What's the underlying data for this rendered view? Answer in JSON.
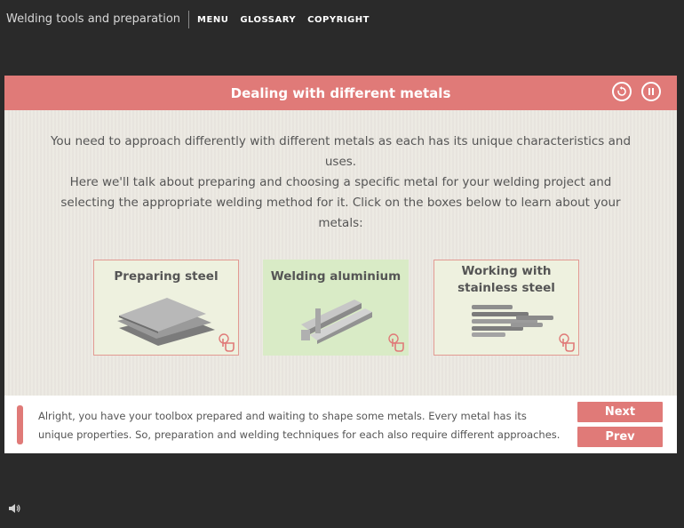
{
  "course": {
    "title": "Welding tools and preparation"
  },
  "nav": {
    "items": [
      "MENU",
      "GLOSSARY",
      "COPYRIGHT"
    ]
  },
  "panel": {
    "title": "Dealing with different metals",
    "intro": [
      "You need to approach differently with different metals as each has its unique characteristics and uses.",
      "Here we'll talk about preparing and choosing a specific metal for your welding project and selecting the appropriate welding method for it. Click on the boxes below to learn about your metals:"
    ],
    "cards": [
      {
        "label": "Preparing steel",
        "icon": "steel-sheets-image",
        "selected": false
      },
      {
        "label": "Welding aluminium",
        "icon": "aluminium-profiles-image",
        "selected": true
      },
      {
        "label": "Working with stainless steel",
        "icon": "stainless-steel-pipes-image",
        "selected": false
      }
    ]
  },
  "footer": {
    "text": "Alright, you have your toolbox prepared and waiting to shape some metals. Every metal has its unique properties. So, preparation and welding techniques for each also require different approaches.",
    "next_label": "Next",
    "prev_label": "Prev"
  },
  "colors": {
    "accent": "#e07a78",
    "card_bg": "#eef1df",
    "card_selected_bg": "#d9ebc6",
    "page_bg": "#2a2a2a"
  }
}
